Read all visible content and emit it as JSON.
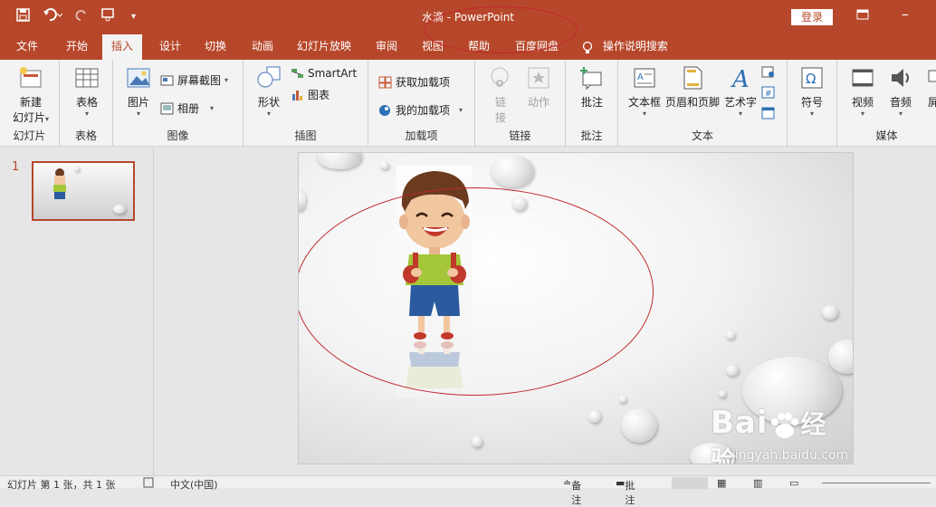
{
  "window": {
    "title": "水滴 - PowerPoint",
    "login_label": "登录"
  },
  "qat": {
    "save_icon": "save-icon",
    "undo_icon": "undo-icon",
    "redo_icon": "redo-icon",
    "present_icon": "present-from-start-icon",
    "customize_icon": "customize-qat-icon"
  },
  "tabs": [
    {
      "label": "文件"
    },
    {
      "label": "开始"
    },
    {
      "label": "插入"
    },
    {
      "label": "设计"
    },
    {
      "label": "切换"
    },
    {
      "label": "动画"
    },
    {
      "label": "幻灯片放映"
    },
    {
      "label": "审阅"
    },
    {
      "label": "视图"
    },
    {
      "label": "帮助"
    },
    {
      "label": "百度网盘"
    },
    {
      "label": "操作说明搜索"
    }
  ],
  "ribbon": {
    "slides": {
      "new_slide": "新建",
      "new_slide2": "幻灯片",
      "group": "幻灯片"
    },
    "tables": {
      "table": "表格",
      "group": "表格"
    },
    "images": {
      "picture": "图片",
      "screenshot": "屏幕截图",
      "album": "相册",
      "group": "图像"
    },
    "illustrations": {
      "shapes": "形状",
      "smartart": "SmartArt",
      "chart": "图表",
      "group": "插图"
    },
    "addins": {
      "get": "获取加载项",
      "my": "我的加载项",
      "group": "加载项"
    },
    "links": {
      "link": "链",
      "link2": "接",
      "action": "动作",
      "group": "链接"
    },
    "comments": {
      "comment": "批注",
      "group": "批注"
    },
    "text": {
      "textbox": "文本框",
      "header_footer": "页眉和页脚",
      "wordart": "艺术字",
      "group": "文本"
    },
    "symbols": {
      "symbol": "符号"
    },
    "media": {
      "video": "视频",
      "audio": "音频",
      "screen_rec": "屏",
      "group": "媒体"
    }
  },
  "left_pane": {
    "slide_number": "1"
  },
  "statusbar": {
    "slide_info": "幻灯片 第 1 张，共 1 张",
    "language": "中文(中国)",
    "notes": "备注",
    "comments": "批注"
  },
  "watermark": {
    "brand": "Bai",
    "brand_suffix": "经验",
    "url": "jingyan.baidu.com"
  },
  "colors": {
    "accent": "#b7472a",
    "annotation": "#c0282d"
  }
}
